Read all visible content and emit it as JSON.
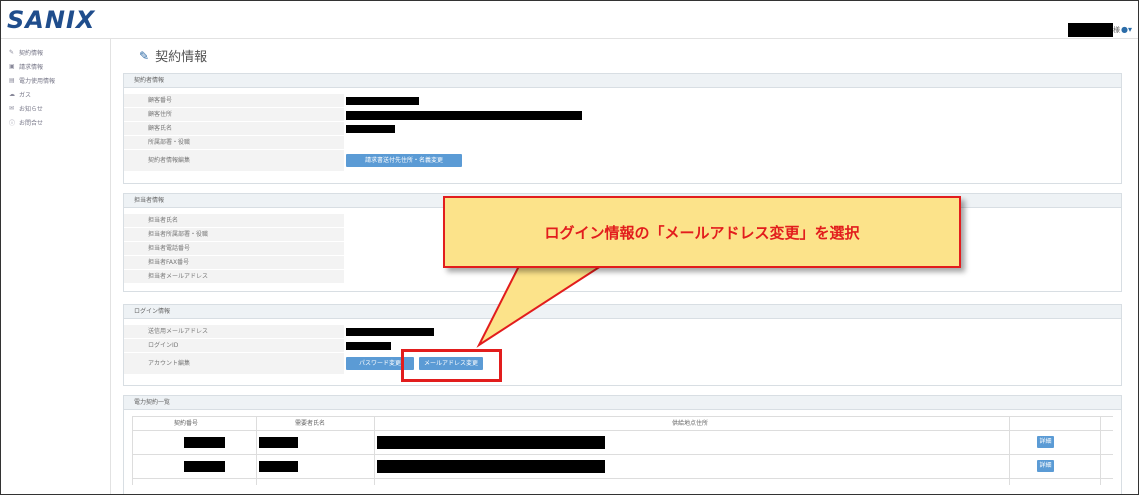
{
  "header": {
    "logo_text": "SANIX",
    "user_suffix": "様",
    "user_icon": "user-icon"
  },
  "sidebar": {
    "items": [
      {
        "icon": "edit-icon",
        "label": "契約情報"
      },
      {
        "icon": "building-icon",
        "label": "請求情報"
      },
      {
        "icon": "chart-icon",
        "label": "電力使用情報"
      },
      {
        "icon": "cloud-icon",
        "label": "ガス"
      },
      {
        "icon": "mail-icon",
        "label": "お知らせ"
      },
      {
        "icon": "question-icon",
        "label": "お問合せ"
      }
    ]
  },
  "page": {
    "title": "契約情報",
    "title_icon": "edit-icon"
  },
  "contractor": {
    "heading": "契約者情報",
    "rows": [
      {
        "label": "顧客番号"
      },
      {
        "label": "顧客住所"
      },
      {
        "label": "顧客氏名"
      },
      {
        "label": "所属部署・役職"
      },
      {
        "label": "契約者情報編集"
      }
    ],
    "edit_button": "請求書送付先住所・名義変更"
  },
  "contact": {
    "heading": "担当者情報",
    "rows": [
      {
        "label": "担当者氏名"
      },
      {
        "label": "担当者所属部署・役職"
      },
      {
        "label": "担当者電話番号"
      },
      {
        "label": "担当者FAX番号"
      },
      {
        "label": "担当者メールアドレス"
      }
    ]
  },
  "login": {
    "heading": "ログイン情報",
    "rows": [
      {
        "label": "送信用メールアドレス"
      },
      {
        "label": "ログインID"
      },
      {
        "label": "アカウント編集"
      }
    ],
    "password_button": "パスワード変更",
    "email_button": "メールアドレス変更"
  },
  "contracts": {
    "heading": "電力契約一覧",
    "columns": [
      "契約番号",
      "需要者氏名",
      "供給地点住所"
    ],
    "rows": [
      {
        "detail_button": "詳細"
      },
      {
        "detail_button": "詳細"
      }
    ]
  },
  "callout": {
    "text": "ログイン情報の「メールアドレス変更」を選択"
  },
  "colors": {
    "brand": "#1f4d8c",
    "button": "#5b9bd5",
    "callout_fill": "#fce38a",
    "callout_border": "#e21d1d"
  }
}
